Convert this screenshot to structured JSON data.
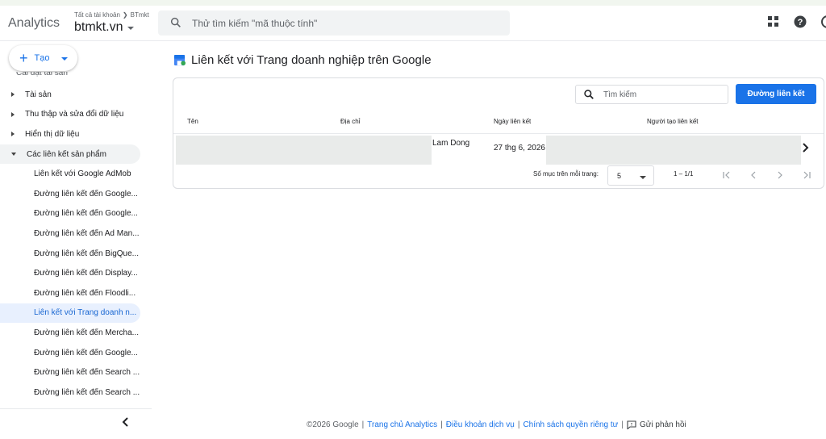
{
  "header": {
    "brand": "Analytics",
    "breadcrumb_parent": "Tất cả tài khoản",
    "breadcrumb_child": "BTmkt",
    "account_name": "btmkt.vn",
    "search_placeholder": "Thử tìm kiếm \"mã thuộc tính\""
  },
  "sidebar": {
    "create_label": "Tạo",
    "cut_item": "Cài đặt tài sản",
    "items": [
      {
        "label": "Tài sản"
      },
      {
        "label": "Thu thập và sửa đổi dữ liệu"
      },
      {
        "label": "Hiển thị dữ liệu"
      },
      {
        "label": "Các liên kết sản phẩm"
      }
    ],
    "subitems": [
      {
        "label": "Liên kết với Google AdMob"
      },
      {
        "label": "Đường liên kết đến Google..."
      },
      {
        "label": "Đường liên kết đến Google..."
      },
      {
        "label": "Đường liên kết đến Ad Man..."
      },
      {
        "label": "Đường liên kết đến BigQue..."
      },
      {
        "label": "Đường liên kết đến Display..."
      },
      {
        "label": "Đường liên kết đến Floodli..."
      },
      {
        "label": "Liên kết với Trang doanh n..."
      },
      {
        "label": "Đường liên kết đến Mercha..."
      },
      {
        "label": "Đường liên kết đến Google..."
      },
      {
        "label": "Đường liên kết đến Search ..."
      },
      {
        "label": "Đường liên kết đến Search ..."
      }
    ]
  },
  "main": {
    "title": "Liên kết với Trang doanh nghiệp trên Google",
    "table_search_placeholder": "Tìm kiếm",
    "link_button": "Đường liên kết",
    "columns": [
      "Tên",
      "Địa chỉ",
      "Ngày liên kết",
      "Người tạo liên kết"
    ],
    "rows": [
      {
        "address": "Lam Dong",
        "date": "27 thg 6, 2026"
      }
    ],
    "pager": {
      "label": "Số mục trên mỗi trang:",
      "page_size": "5",
      "range": "1 – 1/1"
    }
  },
  "footer": {
    "copyright": "©2026 Google",
    "links": [
      "Trang chủ Analytics",
      "Điều khoản dịch vụ",
      "Chính sách quyền riêng tư"
    ],
    "feedback": "Gửi phản hồi"
  },
  "colors": {
    "accent": "#1a73e8",
    "active_bg": "#e8f0fe",
    "redacted": "#e9ebea"
  }
}
